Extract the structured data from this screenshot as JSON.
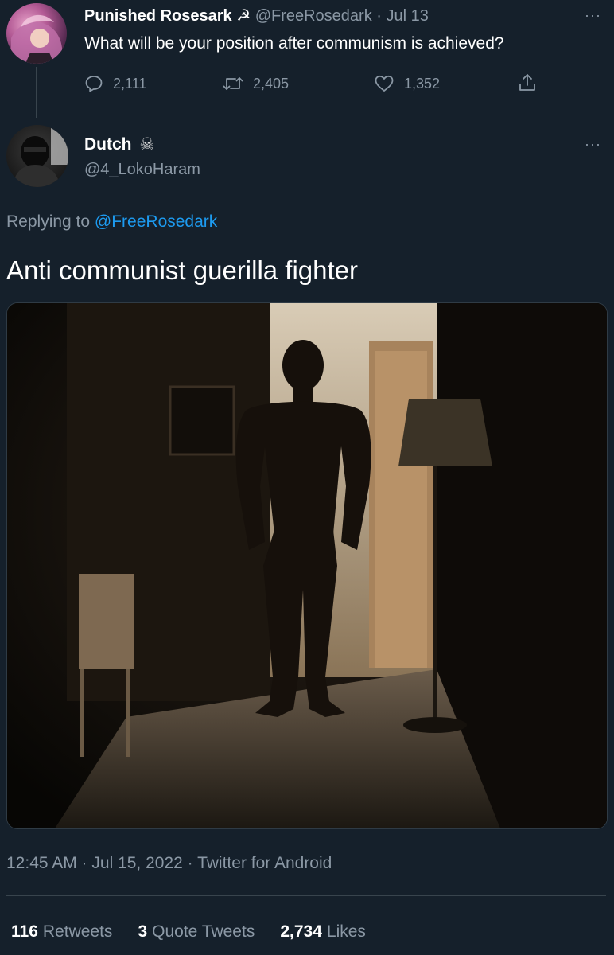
{
  "parent_tweet": {
    "display_name": "Punished Rosesark",
    "name_symbol": "☭",
    "handle_and_date": "@FreeRosedark · Jul 13",
    "text": "What will be your position after communism is achieved?",
    "more_label": "···",
    "actions": {
      "replies": "2,111",
      "retweets": "2,405",
      "likes": "1,352"
    }
  },
  "reply_tweet": {
    "display_name": "Dutch",
    "name_symbol": "☠",
    "handle": "@4_LokoHaram",
    "more_label": "···",
    "replying_prefix": "Replying to",
    "replying_mention": "@FreeRosedark",
    "text": "Anti communist guerilla fighter",
    "timestamp": "12:45 AM · Jul 15, 2022 · Twitter for Android",
    "stats": {
      "retweets_count": "116",
      "retweets_label": "Retweets",
      "quotes_count": "3",
      "quotes_label": "Quote Tweets",
      "likes_count": "2,734",
      "likes_label": "Likes"
    }
  },
  "icons": {
    "reply": "reply-icon",
    "retweet": "retweet-icon",
    "like": "heart-icon",
    "share": "share-icon"
  },
  "colors": {
    "background": "#15202b",
    "primary_text": "#ffffff",
    "secondary_text": "#8b98a5",
    "link": "#1d9bf0",
    "divider": "#38444d"
  }
}
